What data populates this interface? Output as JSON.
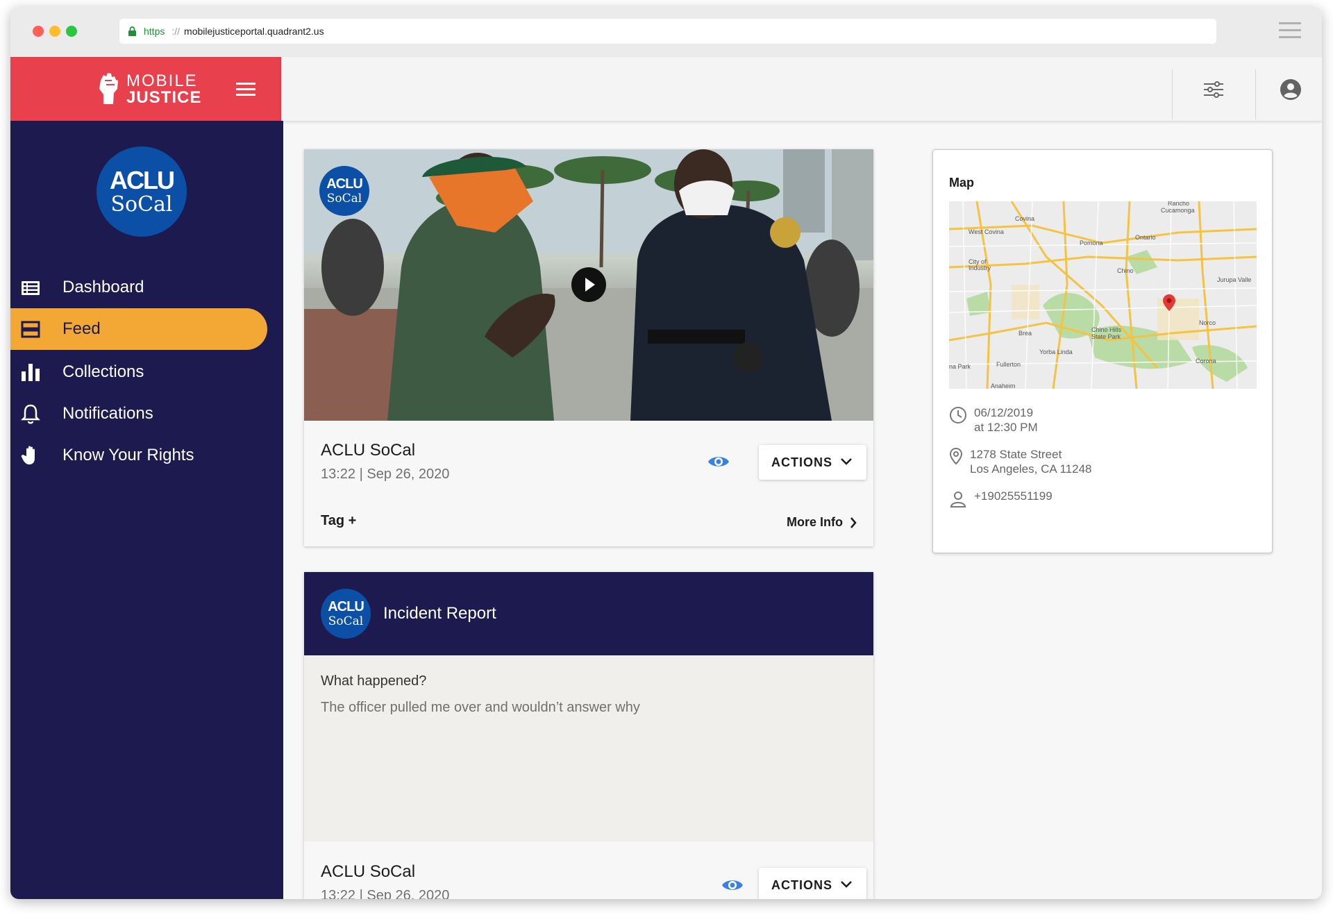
{
  "browser": {
    "scheme": "https",
    "separator": "://",
    "host": "mobilejusticeportal.quadrant2.us"
  },
  "brand": {
    "line1": "MOBILE",
    "line2": "JUSTICE",
    "color": "#e8404d"
  },
  "org_logo": {
    "line1": "ACLU",
    "line2": "SoCal",
    "color": "#0b4fa7"
  },
  "sidebar": {
    "background": "#1c1a4e",
    "active_color": "#f3a734",
    "items": [
      {
        "label": "Dashboard",
        "icon": "dashboard-icon",
        "active": false
      },
      {
        "label": "Feed",
        "icon": "feed-icon",
        "active": true
      },
      {
        "label": "Collections",
        "icon": "bar-chart-icon",
        "active": false
      },
      {
        "label": "Notifications",
        "icon": "bell-icon",
        "active": false
      },
      {
        "label": "Know Your Rights",
        "icon": "hand-icon",
        "active": false
      }
    ]
  },
  "feed": {
    "media_post": {
      "author": "ACLU SoCal",
      "timestamp": "13:22 | Sep 26, 2020",
      "actions_label": "ACTIONS",
      "tag_label": "Tag +",
      "more_info_label": "More Info"
    },
    "incident_post": {
      "header_title": "Incident Report",
      "question": "What happened?",
      "answer": "The officer pulled me over and wouldn’t answer why",
      "author": "ACLU SoCal",
      "timestamp": "13:22 | Sep 26, 2020",
      "actions_label": "ACTIONS"
    }
  },
  "map_panel": {
    "title": "Map",
    "places": [
      "Rancho Cucamonga",
      "Covina",
      "West Covina",
      "Pomona",
      "Ontario",
      "City of Industry",
      "Chino",
      "Jurupa Valle",
      "Norco",
      "Brea",
      "Chino Hills State Park",
      "Yorba Linda",
      "Fullerton",
      "na Park",
      "Corona",
      "Anaheim"
    ],
    "date": "06/12/2019",
    "time": "at 12:30 PM",
    "address_line1": "1278 State Street",
    "address_line2": "Los Angeles, CA 11248",
    "phone": "+19025551199"
  }
}
